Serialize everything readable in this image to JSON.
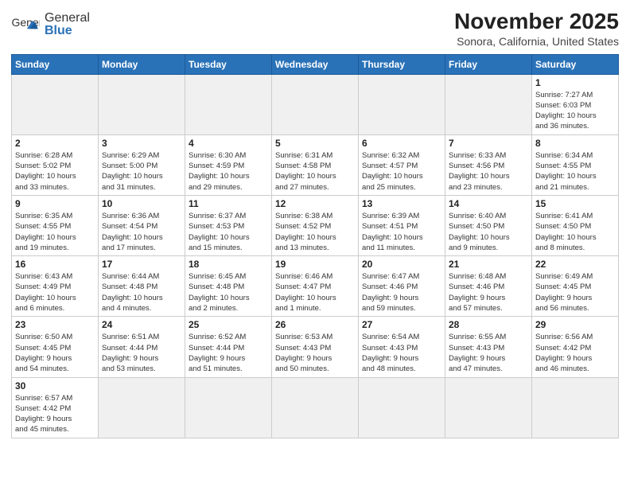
{
  "header": {
    "logo_general": "General",
    "logo_blue": "Blue",
    "title": "November 2025",
    "subtitle": "Sonora, California, United States"
  },
  "weekdays": [
    "Sunday",
    "Monday",
    "Tuesday",
    "Wednesday",
    "Thursday",
    "Friday",
    "Saturday"
  ],
  "weeks": [
    [
      {
        "day": "",
        "info": ""
      },
      {
        "day": "",
        "info": ""
      },
      {
        "day": "",
        "info": ""
      },
      {
        "day": "",
        "info": ""
      },
      {
        "day": "",
        "info": ""
      },
      {
        "day": "",
        "info": ""
      },
      {
        "day": "1",
        "info": "Sunrise: 7:27 AM\nSunset: 6:03 PM\nDaylight: 10 hours\nand 36 minutes."
      }
    ],
    [
      {
        "day": "2",
        "info": "Sunrise: 6:28 AM\nSunset: 5:02 PM\nDaylight: 10 hours\nand 33 minutes."
      },
      {
        "day": "3",
        "info": "Sunrise: 6:29 AM\nSunset: 5:00 PM\nDaylight: 10 hours\nand 31 minutes."
      },
      {
        "day": "4",
        "info": "Sunrise: 6:30 AM\nSunset: 4:59 PM\nDaylight: 10 hours\nand 29 minutes."
      },
      {
        "day": "5",
        "info": "Sunrise: 6:31 AM\nSunset: 4:58 PM\nDaylight: 10 hours\nand 27 minutes."
      },
      {
        "day": "6",
        "info": "Sunrise: 6:32 AM\nSunset: 4:57 PM\nDaylight: 10 hours\nand 25 minutes."
      },
      {
        "day": "7",
        "info": "Sunrise: 6:33 AM\nSunset: 4:56 PM\nDaylight: 10 hours\nand 23 minutes."
      },
      {
        "day": "8",
        "info": "Sunrise: 6:34 AM\nSunset: 4:55 PM\nDaylight: 10 hours\nand 21 minutes."
      }
    ],
    [
      {
        "day": "9",
        "info": "Sunrise: 6:35 AM\nSunset: 4:55 PM\nDaylight: 10 hours\nand 19 minutes."
      },
      {
        "day": "10",
        "info": "Sunrise: 6:36 AM\nSunset: 4:54 PM\nDaylight: 10 hours\nand 17 minutes."
      },
      {
        "day": "11",
        "info": "Sunrise: 6:37 AM\nSunset: 4:53 PM\nDaylight: 10 hours\nand 15 minutes."
      },
      {
        "day": "12",
        "info": "Sunrise: 6:38 AM\nSunset: 4:52 PM\nDaylight: 10 hours\nand 13 minutes."
      },
      {
        "day": "13",
        "info": "Sunrise: 6:39 AM\nSunset: 4:51 PM\nDaylight: 10 hours\nand 11 minutes."
      },
      {
        "day": "14",
        "info": "Sunrise: 6:40 AM\nSunset: 4:50 PM\nDaylight: 10 hours\nand 9 minutes."
      },
      {
        "day": "15",
        "info": "Sunrise: 6:41 AM\nSunset: 4:50 PM\nDaylight: 10 hours\nand 8 minutes."
      }
    ],
    [
      {
        "day": "16",
        "info": "Sunrise: 6:43 AM\nSunset: 4:49 PM\nDaylight: 10 hours\nand 6 minutes."
      },
      {
        "day": "17",
        "info": "Sunrise: 6:44 AM\nSunset: 4:48 PM\nDaylight: 10 hours\nand 4 minutes."
      },
      {
        "day": "18",
        "info": "Sunrise: 6:45 AM\nSunset: 4:48 PM\nDaylight: 10 hours\nand 2 minutes."
      },
      {
        "day": "19",
        "info": "Sunrise: 6:46 AM\nSunset: 4:47 PM\nDaylight: 10 hours\nand 1 minute."
      },
      {
        "day": "20",
        "info": "Sunrise: 6:47 AM\nSunset: 4:46 PM\nDaylight: 9 hours\nand 59 minutes."
      },
      {
        "day": "21",
        "info": "Sunrise: 6:48 AM\nSunset: 4:46 PM\nDaylight: 9 hours\nand 57 minutes."
      },
      {
        "day": "22",
        "info": "Sunrise: 6:49 AM\nSunset: 4:45 PM\nDaylight: 9 hours\nand 56 minutes."
      }
    ],
    [
      {
        "day": "23",
        "info": "Sunrise: 6:50 AM\nSunset: 4:45 PM\nDaylight: 9 hours\nand 54 minutes."
      },
      {
        "day": "24",
        "info": "Sunrise: 6:51 AM\nSunset: 4:44 PM\nDaylight: 9 hours\nand 53 minutes."
      },
      {
        "day": "25",
        "info": "Sunrise: 6:52 AM\nSunset: 4:44 PM\nDaylight: 9 hours\nand 51 minutes."
      },
      {
        "day": "26",
        "info": "Sunrise: 6:53 AM\nSunset: 4:43 PM\nDaylight: 9 hours\nand 50 minutes."
      },
      {
        "day": "27",
        "info": "Sunrise: 6:54 AM\nSunset: 4:43 PM\nDaylight: 9 hours\nand 48 minutes."
      },
      {
        "day": "28",
        "info": "Sunrise: 6:55 AM\nSunset: 4:43 PM\nDaylight: 9 hours\nand 47 minutes."
      },
      {
        "day": "29",
        "info": "Sunrise: 6:56 AM\nSunset: 4:42 PM\nDaylight: 9 hours\nand 46 minutes."
      }
    ],
    [
      {
        "day": "30",
        "info": "Sunrise: 6:57 AM\nSunset: 4:42 PM\nDaylight: 9 hours\nand 45 minutes."
      },
      {
        "day": "",
        "info": ""
      },
      {
        "day": "",
        "info": ""
      },
      {
        "day": "",
        "info": ""
      },
      {
        "day": "",
        "info": ""
      },
      {
        "day": "",
        "info": ""
      },
      {
        "day": "",
        "info": ""
      }
    ]
  ]
}
